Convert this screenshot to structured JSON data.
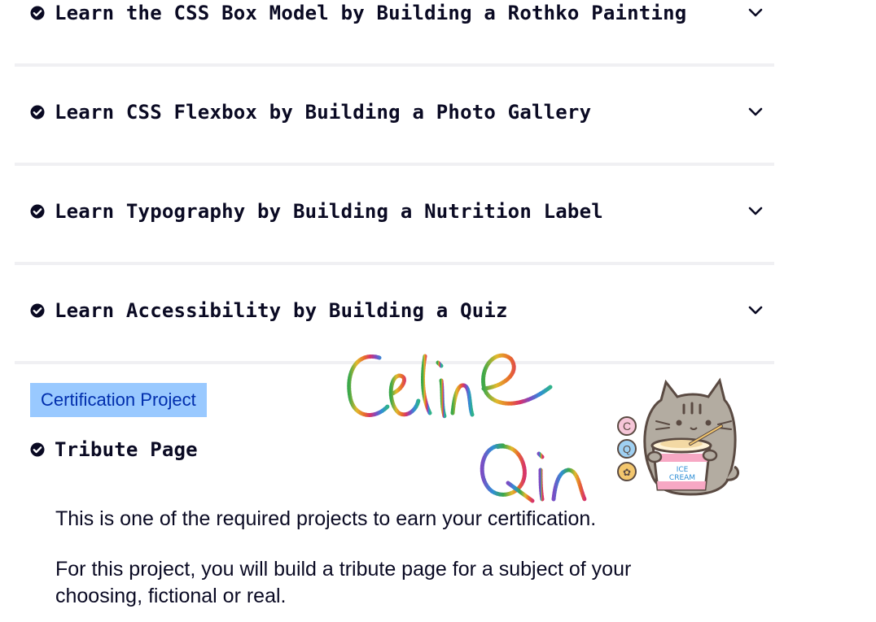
{
  "blocks": [
    {
      "label": "Learn the CSS Box Model by Building a Rothko Painting",
      "completed": true
    },
    {
      "label": "Learn CSS Flexbox by Building a Photo Gallery",
      "completed": true
    },
    {
      "label": "Learn Typography by Building a Nutrition Label",
      "completed": true
    },
    {
      "label": "Learn Accessibility by Building a Quiz",
      "completed": true
    }
  ],
  "certification": {
    "badge_label": "Certification Project",
    "project_title": "Tribute Page",
    "completed": true,
    "description_1": "This is one of the required projects to earn your certification.",
    "description_2": "For this project, you will build a tribute page for a subject of your choosing, fictional or real."
  },
  "signature": {
    "line_1": "Celine",
    "line_2": "Qin"
  },
  "sticker": {
    "badge_letters": [
      "C",
      "Q",
      "✿"
    ],
    "cup_text_1": "ICE",
    "cup_text_2": "CREAM"
  },
  "icons": {
    "completed": "check-circle-icon",
    "expand": "chevron-down-icon"
  },
  "colors": {
    "text": "#0a0a23",
    "badge_bg": "#99c9ff",
    "badge_text": "#002ead",
    "separator": "#f0f0f3"
  }
}
